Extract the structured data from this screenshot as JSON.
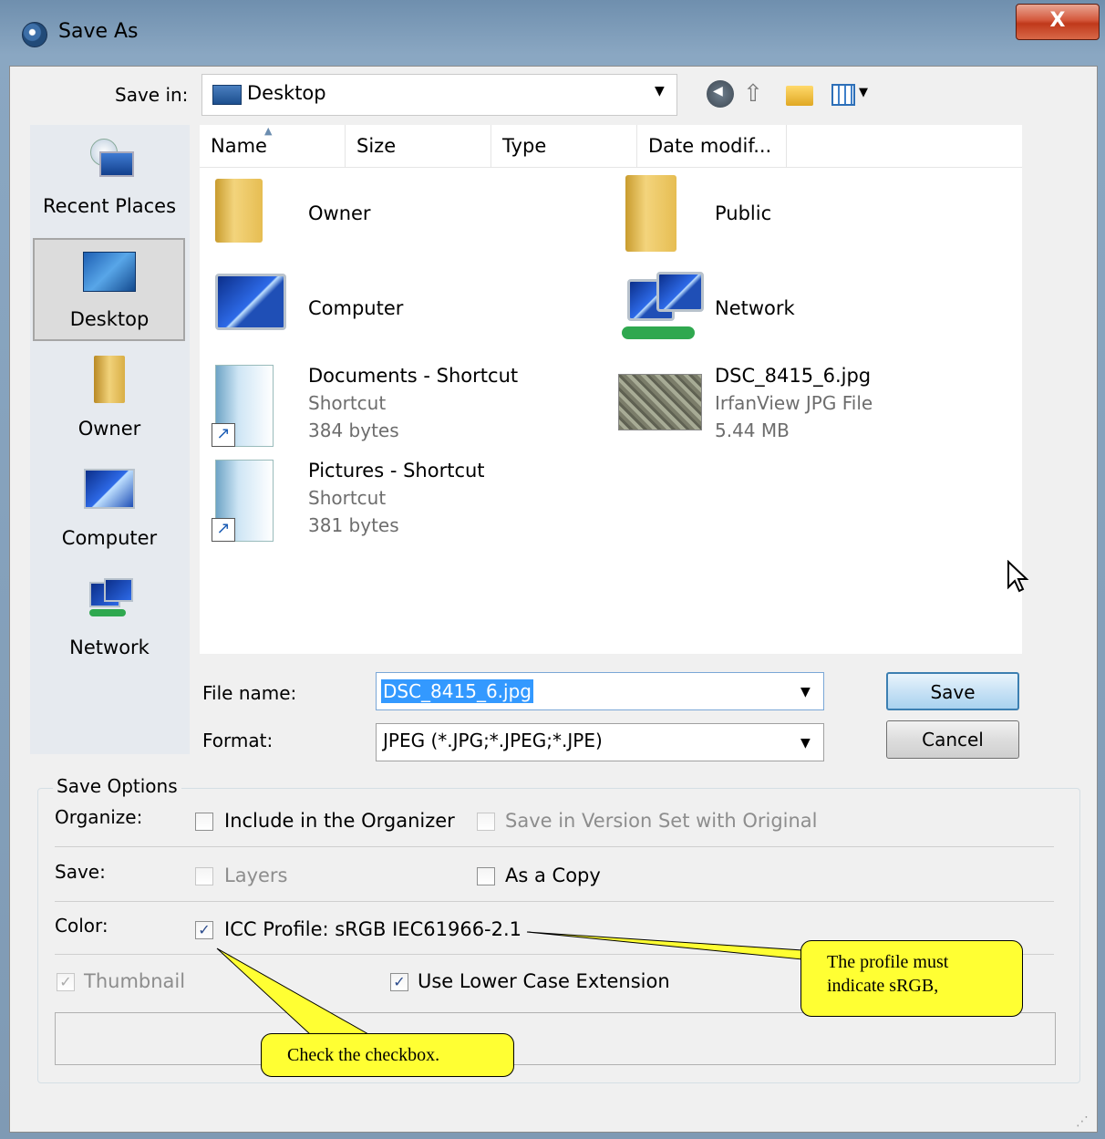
{
  "window": {
    "title": "Save As",
    "close_label": "X"
  },
  "toolbar": {
    "save_in_label": "Save in:",
    "save_in_value": "Desktop",
    "icons": [
      "back-icon",
      "up-folder-icon",
      "new-folder-icon",
      "views-menu-icon"
    ]
  },
  "places": [
    {
      "label": "Recent Places",
      "icon": "recent-places-icon"
    },
    {
      "label": "Desktop",
      "icon": "desktop-icon",
      "selected": true
    },
    {
      "label": "Owner",
      "icon": "user-folder-icon"
    },
    {
      "label": "Computer",
      "icon": "computer-icon"
    },
    {
      "label": "Network",
      "icon": "network-icon"
    }
  ],
  "columns": [
    "Name",
    "Size",
    "Type",
    "Date modif..."
  ],
  "files": [
    {
      "name": "Owner",
      "icon": "user-folder-icon"
    },
    {
      "name": "Public",
      "icon": "folder-icon"
    },
    {
      "name": "Computer",
      "icon": "computer-icon"
    },
    {
      "name": "Network",
      "icon": "network-icon"
    },
    {
      "name": "Documents - Shortcut",
      "type": "Shortcut",
      "size": "384 bytes",
      "icon": "shortcut-icon"
    },
    {
      "name": "DSC_8415_6.jpg",
      "type": "IrfanView JPG File",
      "size": "5.44 MB",
      "icon": "image-thumbnail"
    },
    {
      "name": "Pictures - Shortcut",
      "type": "Shortcut",
      "size": "381 bytes",
      "icon": "shortcut-icon"
    }
  ],
  "form": {
    "file_name_label": "File name:",
    "file_name_value": "DSC_8415_6.jpg",
    "format_label": "Format:",
    "format_value": "JPEG (*.JPG;*.JPEG;*.JPE)",
    "save_button": "Save",
    "cancel_button": "Cancel"
  },
  "save_options": {
    "legend": "Save Options",
    "organize_label": "Organize:",
    "include_organizer": {
      "label": "Include in the Organizer",
      "checked": false,
      "enabled": true
    },
    "version_set": {
      "label": "Save in Version Set with Original",
      "checked": false,
      "enabled": false
    },
    "save_label": "Save:",
    "layers": {
      "label": "Layers",
      "checked": false,
      "enabled": false
    },
    "as_copy": {
      "label": "As a Copy",
      "checked": false,
      "enabled": true
    },
    "color_label": "Color:",
    "icc_profile": {
      "label": "ICC Profile:  sRGB IEC61966-2.1",
      "checked": true,
      "enabled": true
    },
    "thumbnail": {
      "label": "Thumbnail",
      "checked": true,
      "enabled": false
    },
    "lower_case_ext": {
      "label": "Use Lower Case Extension",
      "checked": true,
      "enabled": true
    }
  },
  "callouts": {
    "profile_note_line1": "The profile must",
    "profile_note_line2": "indicate sRGB,",
    "checkbox_note": "Check the checkbox."
  },
  "colors": {
    "callout": "#ffff33",
    "selection": "#3399ff",
    "close_button": "#c0391b"
  }
}
